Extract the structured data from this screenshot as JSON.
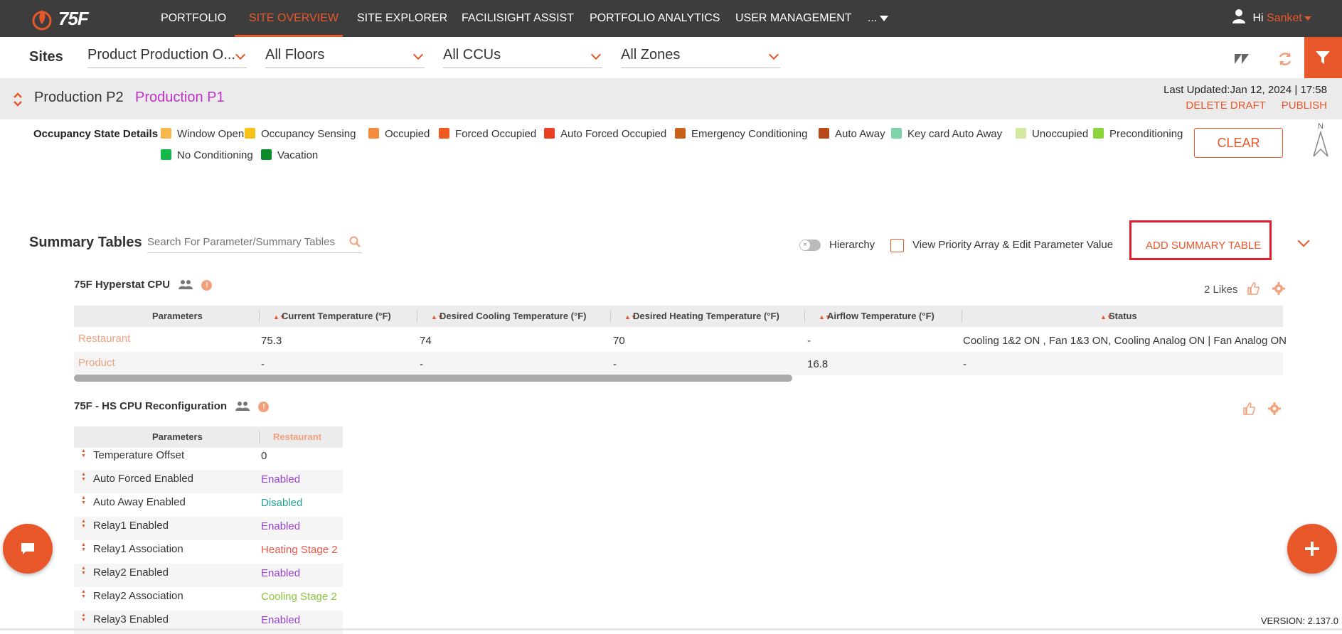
{
  "brand": {
    "logo_text": "75F"
  },
  "nav": {
    "items": [
      "PORTFOLIO",
      "SITE OVERVIEW",
      "SITE EXPLORER",
      "FACILISIGHT ASSIST",
      "PORTFOLIO ANALYTICS",
      "USER MANAGEMENT"
    ],
    "active": "SITE OVERVIEW",
    "more_label": "...",
    "greeting": "Hi",
    "user_name": "Sanket"
  },
  "filters": {
    "sites_label": "Sites",
    "site": "Product Production O...",
    "floor": "All Floors",
    "ccu": "All CCUs",
    "zone": "All Zones"
  },
  "header": {
    "site_p2": "Production P2",
    "site_p1": "Production P1",
    "last_updated": "Last Updated:Jan 12, 2024 | 17:58",
    "delete_draft": "DELETE DRAFT",
    "publish": "PUBLISH"
  },
  "occupancy": {
    "label": "Occupancy State Details",
    "legend": [
      {
        "name": "Window Open",
        "color": "#f7b84b"
      },
      {
        "name": "Occupancy Sensing",
        "color": "#f8c21b"
      },
      {
        "name": "Occupied",
        "color": "#f58c3d"
      },
      {
        "name": "Forced Occupied",
        "color": "#f05a1e"
      },
      {
        "name": "Auto Forced Occupied",
        "color": "#e84020"
      },
      {
        "name": "Emergency Conditioning",
        "color": "#c8621a"
      },
      {
        "name": "Auto Away",
        "color": "#b84818"
      },
      {
        "name": "Key card Auto Away",
        "color": "#7fd3a8"
      },
      {
        "name": "Unoccupied",
        "color": "#d4e8a0"
      },
      {
        "name": "Preconditioning",
        "color": "#8cd43c"
      },
      {
        "name": "No Conditioning",
        "color": "#12b84a"
      },
      {
        "name": "Vacation",
        "color": "#0a8a2a"
      }
    ],
    "clear_label": "CLEAR",
    "compass_label": "N"
  },
  "summary": {
    "title": "Summary Tables",
    "search_placeholder": "Search For Parameter/Summary Tables",
    "hierarchy_label": "Hierarchy",
    "priority_label": "View Priority Array & Edit Parameter Value",
    "add_label": "ADD SUMMARY TABLE"
  },
  "table1": {
    "title": "75F Hyperstat CPU",
    "likes": "2 Likes",
    "columns": [
      "Parameters",
      "Current Temperature  (°F)",
      "Desired Cooling Temperature  (°F)",
      "Desired Heating Temperature  (°F)",
      "Airflow Temperature  (°F)",
      "Status"
    ],
    "rows": [
      {
        "name": "Restaurant",
        "values": [
          "75.3",
          "74",
          "70",
          "-",
          "Cooling 1&2 ON , Fan 1&3 ON, Cooling Analog ON | Fan Analog ON"
        ]
      },
      {
        "name": "Product",
        "values": [
          "-",
          "-",
          "-",
          "16.8",
          "-"
        ]
      }
    ]
  },
  "table2": {
    "title": "75F - HS CPU Reconfiguration",
    "columns": [
      "Parameters",
      "Restaurant"
    ],
    "rows": [
      {
        "name": "Temperature Offset",
        "value": "0",
        "color": "#333333"
      },
      {
        "name": "Auto Forced Enabled",
        "value": "Enabled",
        "color": "#9b3fd1"
      },
      {
        "name": "Auto Away Enabled",
        "value": "Disabled",
        "color": "#1fa39a"
      },
      {
        "name": "Relay1 Enabled",
        "value": "Enabled",
        "color": "#9b3fd1"
      },
      {
        "name": "Relay1 Association",
        "value": "Heating Stage 2",
        "color": "#e8574a"
      },
      {
        "name": "Relay2 Enabled",
        "value": "Enabled",
        "color": "#9b3fd1"
      },
      {
        "name": "Relay2 Association",
        "value": "Cooling Stage 2",
        "color": "#8cc63f"
      },
      {
        "name": "Relay3 Enabled",
        "value": "Enabled",
        "color": "#9b3fd1"
      }
    ]
  },
  "version": "VERSION: 2.137.0",
  "colors": {
    "accent": "#e8572a",
    "highlight": "#e01e2e",
    "topbar": "#3d3d3d"
  }
}
